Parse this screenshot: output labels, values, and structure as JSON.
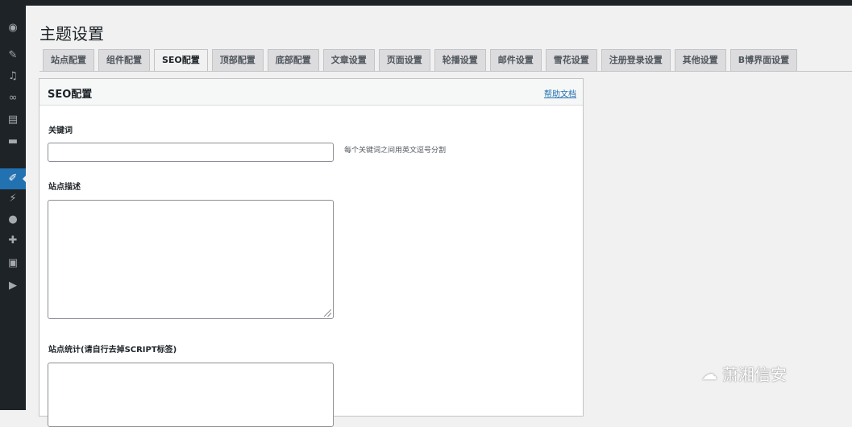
{
  "page_title": "主题设置",
  "tabs": [
    {
      "label": "站点配置"
    },
    {
      "label": "组件配置"
    },
    {
      "label": "SEO配置"
    },
    {
      "label": "顶部配置"
    },
    {
      "label": "底部配置"
    },
    {
      "label": "文章设置"
    },
    {
      "label": "页面设置"
    },
    {
      "label": "轮播设置"
    },
    {
      "label": "邮件设置"
    },
    {
      "label": "雪花设置"
    },
    {
      "label": "注册登录设置"
    },
    {
      "label": "其他设置"
    },
    {
      "label": "B博界面设置"
    }
  ],
  "active_tab": "SEO配置",
  "panel": {
    "title": "SEO配置",
    "help_link": "帮助文档",
    "fields": {
      "keywords_label": "关键词",
      "keywords_value": "",
      "keywords_hint": "每个关键词之间用英文逗号分割",
      "description_label": "站点描述",
      "description_value": "",
      "stats_label": "站点统计(请自行去掉SCRIPT标签)",
      "stats_value": ""
    }
  },
  "sidebar_icons": [
    "dashboard-icon",
    "pin-icon",
    "media-icon",
    "link-icon",
    "pages-icon",
    "comments-icon",
    "appearance-icon",
    "plugins-icon",
    "users-icon",
    "tools-icon",
    "settings-icon",
    "play-icon"
  ],
  "watermark": "萧湘信安",
  "colors": {
    "accent": "#2271b1",
    "sidebar": "#1d2327"
  }
}
